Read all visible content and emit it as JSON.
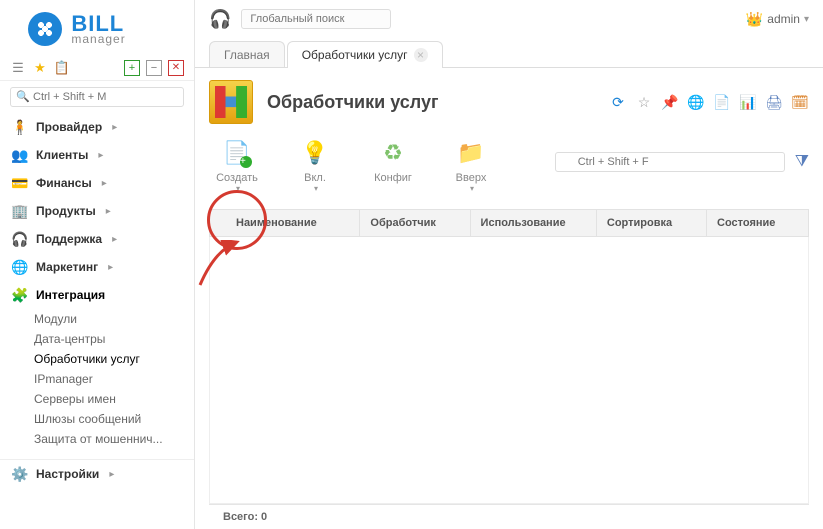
{
  "brand": {
    "name": "BILL",
    "sub": "manager"
  },
  "globalSearch": {
    "placeholder": "Глобальный поиск"
  },
  "user": {
    "name": "admin"
  },
  "sideSearch": {
    "placeholder": "Ctrl + Shift + M"
  },
  "sidebar": {
    "items": [
      {
        "label": "Провайдер"
      },
      {
        "label": "Клиенты"
      },
      {
        "label": "Финансы"
      },
      {
        "label": "Продукты"
      },
      {
        "label": "Поддержка"
      },
      {
        "label": "Маркетинг"
      },
      {
        "label": "Интеграция"
      },
      {
        "label": "Настройки"
      }
    ],
    "integrationSub": [
      {
        "label": "Модули"
      },
      {
        "label": "Дата-центры"
      },
      {
        "label": "Обработчики услуг"
      },
      {
        "label": "IPmanager"
      },
      {
        "label": "Серверы имен"
      },
      {
        "label": "Шлюзы сообщений"
      },
      {
        "label": "Защита от мошеннич..."
      }
    ]
  },
  "tabs": [
    {
      "label": "Главная"
    },
    {
      "label": "Обработчики услуг"
    }
  ],
  "page": {
    "title": "Обработчики услуг",
    "actions": {
      "create": "Создать",
      "on": "Вкл.",
      "config": "Конфиг",
      "up": "Вверх"
    },
    "filterPlaceholder": "Ctrl + Shift + F",
    "columns": [
      "",
      "Наименование",
      "Обработчик",
      "Использование",
      "Сортировка",
      "Состояние"
    ],
    "footer": "Всего: 0"
  }
}
